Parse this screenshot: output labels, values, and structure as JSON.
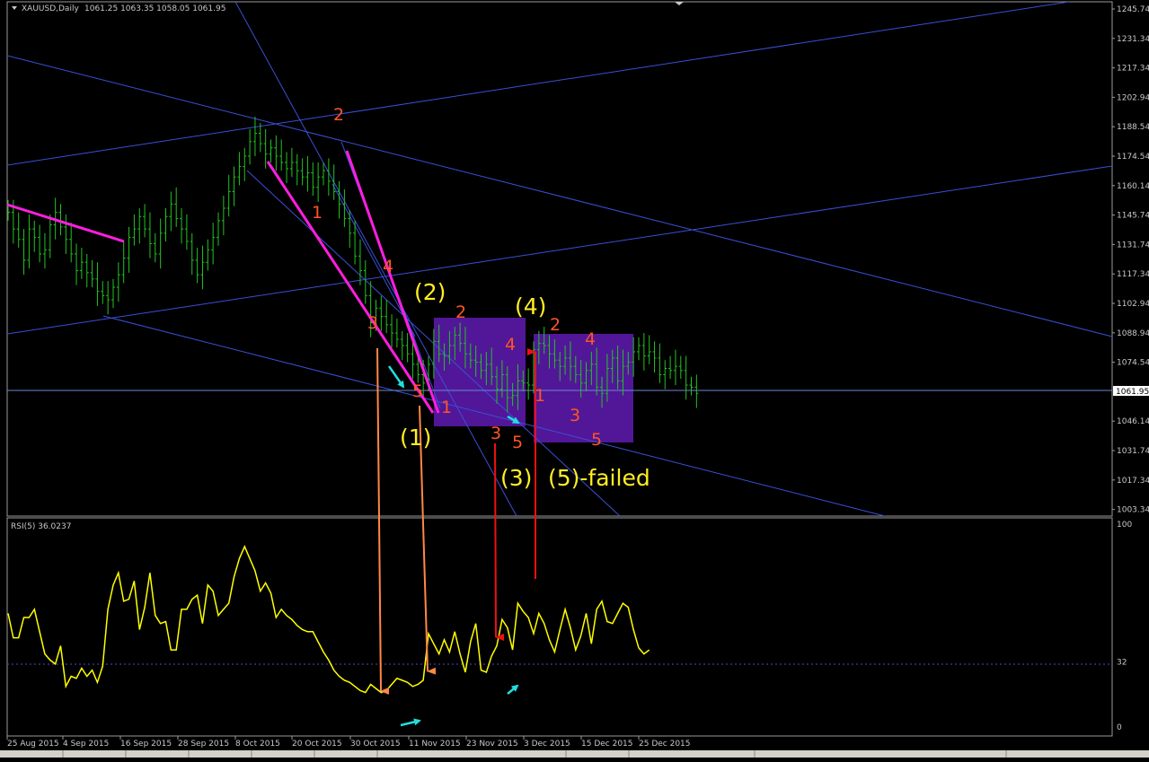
{
  "header": {
    "symbol": "XAUUSD,Daily",
    "ohlc": "1061.25 1063.35 1058.05 1061.95",
    "rsi_title": "RSI(5) 36.0237"
  },
  "colors": {
    "background": "#000000",
    "bars": "#22c322",
    "frame": "#9a9a9a",
    "trendline": "#3b4fd6",
    "magenta": "#ff1ee0",
    "rsi": "#ffff00",
    "box": "#5a1aa8",
    "count_orange": "#ff5522",
    "wave_yellow": "#ffee22",
    "arrow_orange": "#ff8844",
    "arrow_red": "#ee1111",
    "arrow_cyan": "#22dddd"
  },
  "chart_data": [
    {
      "type": "candlestick",
      "title": "XAUUSD,Daily",
      "ylim": [
        1000.0,
        1250.0
      ],
      "y_ticks": [
        "1245.74",
        "1231.34",
        "1217.34",
        "1202.94",
        "1188.54",
        "1174.54",
        "1160.14",
        "1145.74",
        "1131.74",
        "1117.34",
        "1102.94",
        "1088.94",
        "1074.54",
        "1061.95",
        "1046.14",
        "1031.74",
        "1017.34",
        "1003.34"
      ],
      "current_price": "1061.95",
      "x_ticks": [
        "25 Aug 2015",
        "4 Sep 2015",
        "16 Sep 2015",
        "28 Sep 2015",
        "8 Oct 2015",
        "20 Oct 2015",
        "30 Oct 2015",
        "11 Nov 2015",
        "23 Nov 2015",
        "3 Dec 2015",
        "15 Dec 2015",
        "25 Dec 2015"
      ],
      "close_series": [
        1148,
        1140,
        1135,
        1125,
        1140,
        1136,
        1128,
        1130,
        1142,
        1148,
        1141,
        1135,
        1128,
        1120,
        1124,
        1119,
        1116,
        1110,
        1108,
        1106,
        1112,
        1118,
        1126,
        1136,
        1140,
        1146,
        1140,
        1133,
        1128,
        1138,
        1146,
        1152,
        1145,
        1140,
        1134,
        1125,
        1118,
        1124,
        1130,
        1136,
        1144,
        1150,
        1158,
        1165,
        1170,
        1175,
        1182,
        1186,
        1181,
        1176,
        1179,
        1175,
        1172,
        1169,
        1172,
        1168,
        1165,
        1167,
        1160,
        1165,
        1168,
        1163,
        1158,
        1152,
        1145,
        1138,
        1127,
        1120,
        1108,
        1095,
        1102,
        1098,
        1094,
        1090,
        1087,
        1084,
        1080,
        1075,
        1070,
        1066,
        1075,
        1086,
        1080,
        1079,
        1084,
        1089,
        1085,
        1080,
        1077,
        1076,
        1072,
        1075,
        1069,
        1063,
        1070,
        1059,
        1060,
        1067,
        1066,
        1065,
        1082,
        1085,
        1084,
        1080,
        1077,
        1074,
        1078,
        1074,
        1070,
        1066,
        1072,
        1075,
        1064,
        1061,
        1073,
        1078,
        1067,
        1074,
        1076,
        1081,
        1084,
        1079,
        1081,
        1078,
        1070,
        1073,
        1072,
        1074,
        1072,
        1065,
        1064,
        1061
      ]
    },
    {
      "type": "line",
      "title": "RSI(5) 36.0237",
      "ylim": [
        0,
        100
      ],
      "y_ticks": [
        "100",
        "32",
        "0"
      ],
      "series": [
        {
          "values": [
            56,
            44,
            44,
            54,
            54,
            58,
            47,
            36,
            33,
            31,
            40,
            20,
            25,
            24,
            29,
            25,
            28,
            22,
            30,
            58,
            70,
            76,
            62,
            63,
            72,
            48,
            59,
            76,
            55,
            51,
            52,
            38,
            38,
            58,
            58,
            63,
            65,
            51,
            70,
            67,
            55,
            58,
            61,
            74,
            83,
            89,
            83,
            77,
            67,
            71,
            66,
            54,
            58,
            55,
            53,
            50,
            48,
            47,
            47,
            42,
            37,
            33,
            28,
            25,
            23,
            22,
            20,
            18,
            17,
            21,
            19,
            17,
            18,
            21,
            24,
            23,
            22,
            20,
            21,
            23,
            46,
            41,
            36,
            43,
            37,
            47,
            36,
            27,
            42,
            51,
            28,
            27,
            35,
            40,
            53,
            49,
            38,
            61,
            57,
            54,
            46,
            56,
            51,
            43,
            37,
            48,
            58,
            49,
            38,
            45,
            56,
            41,
            58,
            62,
            52,
            51,
            56,
            61,
            59,
            48,
            39,
            36,
            38
          ]
        }
      ]
    }
  ],
  "annotations": {
    "labels": [
      {
        "text": "1",
        "role": "count"
      },
      {
        "text": "2",
        "role": "count"
      },
      {
        "text": "3",
        "role": "count"
      },
      {
        "text": "4",
        "role": "count"
      },
      {
        "text": "5",
        "role": "count"
      },
      {
        "text": "1",
        "role": "count"
      },
      {
        "text": "2",
        "role": "count"
      },
      {
        "text": "3",
        "role": "count"
      },
      {
        "text": "4",
        "role": "count"
      },
      {
        "text": "5",
        "role": "count"
      },
      {
        "text": "1",
        "role": "count"
      },
      {
        "text": "2",
        "role": "count"
      },
      {
        "text": "3",
        "role": "count"
      },
      {
        "text": "4",
        "role": "count"
      },
      {
        "text": "5",
        "role": "count"
      },
      {
        "text": "(1)",
        "role": "wave"
      },
      {
        "text": "(2)",
        "role": "wave"
      },
      {
        "text": "(3)",
        "role": "wave"
      },
      {
        "text": "(4)",
        "role": "wave"
      },
      {
        "text": "(5)-failed",
        "role": "wave"
      }
    ]
  }
}
